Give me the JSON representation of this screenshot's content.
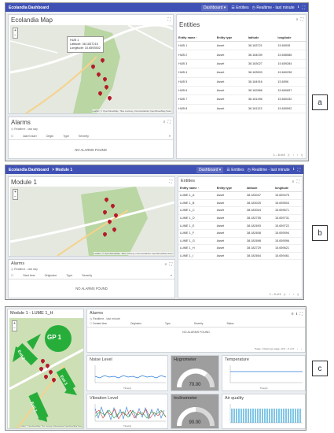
{
  "panel_a": {
    "topbar": {
      "title": "Ecolandia Dashboard",
      "dashboard_label": "Dashboard",
      "entities_label": "Entities",
      "realtime_label": "Realtime - last minute"
    },
    "map_title": "Ecolandia Map",
    "popup": {
      "name": "HUB 1",
      "latitude": "Latitude: 38.1837216",
      "longitude": "Longitude: 15.6593502"
    },
    "attribution": "Leaflet | © OpenStreetMap. Tiles courtesy of Humanitarian OpenStreetMap Team",
    "entities_title": "Entities",
    "columns": [
      "Entity name",
      "Entity type",
      "latitude",
      "longitude"
    ],
    "rows": [
      [
        "HUB 1",
        "Asset",
        "38.183721",
        "15.65935"
      ],
      [
        "HUB 2",
        "Asset",
        "38.184039",
        "15.656586"
      ],
      [
        "HUB 3",
        "Asset",
        "38.183027",
        "15.659284"
      ],
      [
        "HUB 4",
        "Asset",
        "38.183503",
        "15.660298"
      ],
      [
        "HUB 5",
        "Asset",
        "38.184916",
        "15.6596"
      ],
      [
        "HUB 6",
        "Asset",
        "38.182866",
        "15.660657"
      ],
      [
        "HUB 7",
        "Asset",
        "38.181496",
        "15.660432"
      ],
      [
        "HUB 8",
        "Asset",
        "38.181123",
        "15.659592"
      ]
    ],
    "pager": "1 – 8 of 8",
    "alarms_title": "Alarms",
    "alarms_sub": "Realtime - last day",
    "alarm_columns": [
      "Alarm start",
      "Origin",
      "Type",
      "Severity"
    ],
    "no_alarms": "NO ALARMS FOUND",
    "label": "a"
  },
  "panel_b": {
    "topbar": {
      "title": "Ecolandia Dashboard",
      "crumb": "Module 1",
      "dashboard_label": "Dashboard",
      "entities_label": "Entities",
      "realtime_label": "Realtime - last minute"
    },
    "map_title": "Module 1",
    "pin_labels": [
      "LUME 1_A",
      "LUME 1_B",
      "LUME 1_C",
      "LUME 1_D",
      "LUME 1_E",
      "LUME 1_F",
      "LUME 1_G"
    ],
    "attribution": "Leaflet | © OpenStreetMap. Tiles courtesy of Humanitarian OpenStreetMap Team",
    "entities_title": "Entities",
    "columns": [
      "Entity name",
      "Entity type",
      "latitude",
      "longitude"
    ],
    "rows": [
      [
        "LUME 1_A",
        "Asset",
        "38.183047",
        "15.659475"
      ],
      [
        "LUME 1_B",
        "Asset",
        "38.183025",
        "15.659604"
      ],
      [
        "LUME 1_C",
        "Asset",
        "38.183004",
        "15.659671"
      ],
      [
        "LUME 1_D",
        "Asset",
        "38.182755",
        "15.659731"
      ],
      [
        "LUME 1_E",
        "Asset",
        "38.182693",
        "15.659722"
      ],
      [
        "LUME 1_F",
        "Asset",
        "38.182608",
        "15.659594"
      ],
      [
        "LUME 1_G",
        "Asset",
        "38.182698",
        "15.659596"
      ],
      [
        "LUME 1_H",
        "Asset",
        "38.182729",
        "15.659621"
      ],
      [
        "LUME 1_I",
        "Asset",
        "38.182664",
        "15.659461"
      ]
    ],
    "pager": "1 – 9 of 9",
    "alarms_title": "Alarms",
    "alarms_sub": "Realtime - last day",
    "alarm_columns": [
      "Start time",
      "Originator",
      "Type",
      "Severity"
    ],
    "no_alarms": "NO ALARMS FOUND",
    "label": "b"
  },
  "panel_c": {
    "map_title": "Module 1 - LUME 1_H",
    "gp_label": "GP 1",
    "exits": [
      "Exit 1",
      "Exit 2",
      "Exit 3"
    ],
    "attribution": "Leaflet | © OpenStreetMap. Tiles courtesy of Humanitarian OpenStreetMap Team",
    "alarms_title": "Alarms",
    "alarms_sub": "Realtime - last minute",
    "alarm_columns": [
      "Created time",
      "Originator",
      "Type",
      "Severity",
      "Status"
    ],
    "no_alarms": "NO ALARMS FOUND",
    "pager": "Page: 1   Rows per page: 10   0 – 0 of 0",
    "widgets": {
      "noise": "Noise Level",
      "hygrometer": "Hygrometer",
      "hygrometer_value": "70.00",
      "temperature": "Temperature",
      "vibration": "Vibration Level",
      "inclinometer": "Inclinometer",
      "inclinometer_value": "90.00",
      "air": "Air quality",
      "xlabel": "Time(s)"
    },
    "label": "c"
  }
}
